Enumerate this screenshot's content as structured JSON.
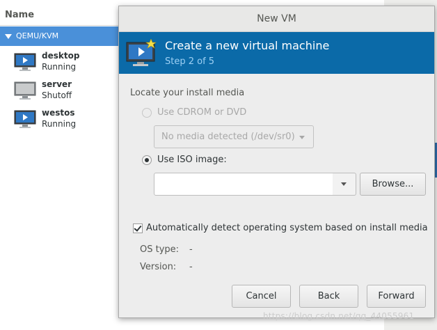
{
  "manager": {
    "column_header": "Name",
    "group_label": "QEMU/KVM",
    "vms": [
      {
        "name": "desktop",
        "state": "Running",
        "icon": "running-monitor-icon"
      },
      {
        "name": "server",
        "state": "Shutoff",
        "icon": "shutoff-monitor-icon"
      },
      {
        "name": "westos",
        "state": "Running",
        "icon": "running-monitor-icon"
      }
    ]
  },
  "dialog": {
    "title": "New VM",
    "banner": {
      "title": "Create a new virtual machine",
      "step": "Step 2 of 5"
    },
    "section_label": "Locate your install media",
    "cdrom_option": "Use CDROM or DVD",
    "cdrom_combo_value": "No media detected (/dev/sr0)",
    "iso_option": "Use ISO image:",
    "iso_path_value": "",
    "browse_label": "Browse...",
    "autodetect_label": "Automatically detect operating system based on install media",
    "autodetect_checked": true,
    "os_type_label": "OS type:",
    "os_type_value": "-",
    "version_label": "Version:",
    "version_value": "-",
    "buttons": {
      "cancel": "Cancel",
      "back": "Back",
      "forward": "Forward"
    }
  },
  "watermark": "https://blog.csdn.net/qq_44055961",
  "colors": {
    "banner": "#0b6aa8",
    "selection": "#4a90d9"
  }
}
